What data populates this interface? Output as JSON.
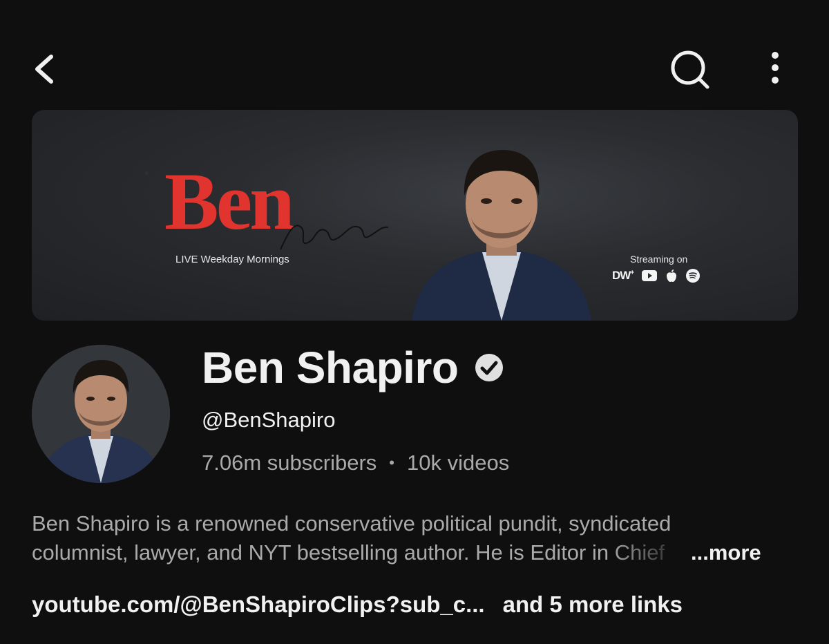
{
  "topbar": {
    "back_icon": "chevron-left-icon",
    "search_icon": "search-icon",
    "more_icon": "more-vertical-icon"
  },
  "banner": {
    "logo_text": "Ben",
    "tagline": "LIVE Weekday Mornings",
    "streaming_label": "Streaming on",
    "platforms": [
      "DW+",
      "youtube-icon",
      "apple-icon",
      "spotify-icon"
    ],
    "logo_color": "#e1342e"
  },
  "channel": {
    "name": "Ben Shapiro",
    "verified_icon": "verified-check-icon",
    "handle": "@BenShapiro",
    "subscribers": "7.06m subscribers",
    "separator": "•",
    "videos": "10k videos"
  },
  "description": {
    "line1": "Ben Shapiro is a renowned conservative political pundit, syndicated",
    "line2": "columnist, lawyer, and NYT bestselling author. He is Editor in Chief",
    "more_label": "...more"
  },
  "links": {
    "primary": "youtube.com/@BenShapiroClips?sub_c...",
    "more": "and 5 more links"
  }
}
